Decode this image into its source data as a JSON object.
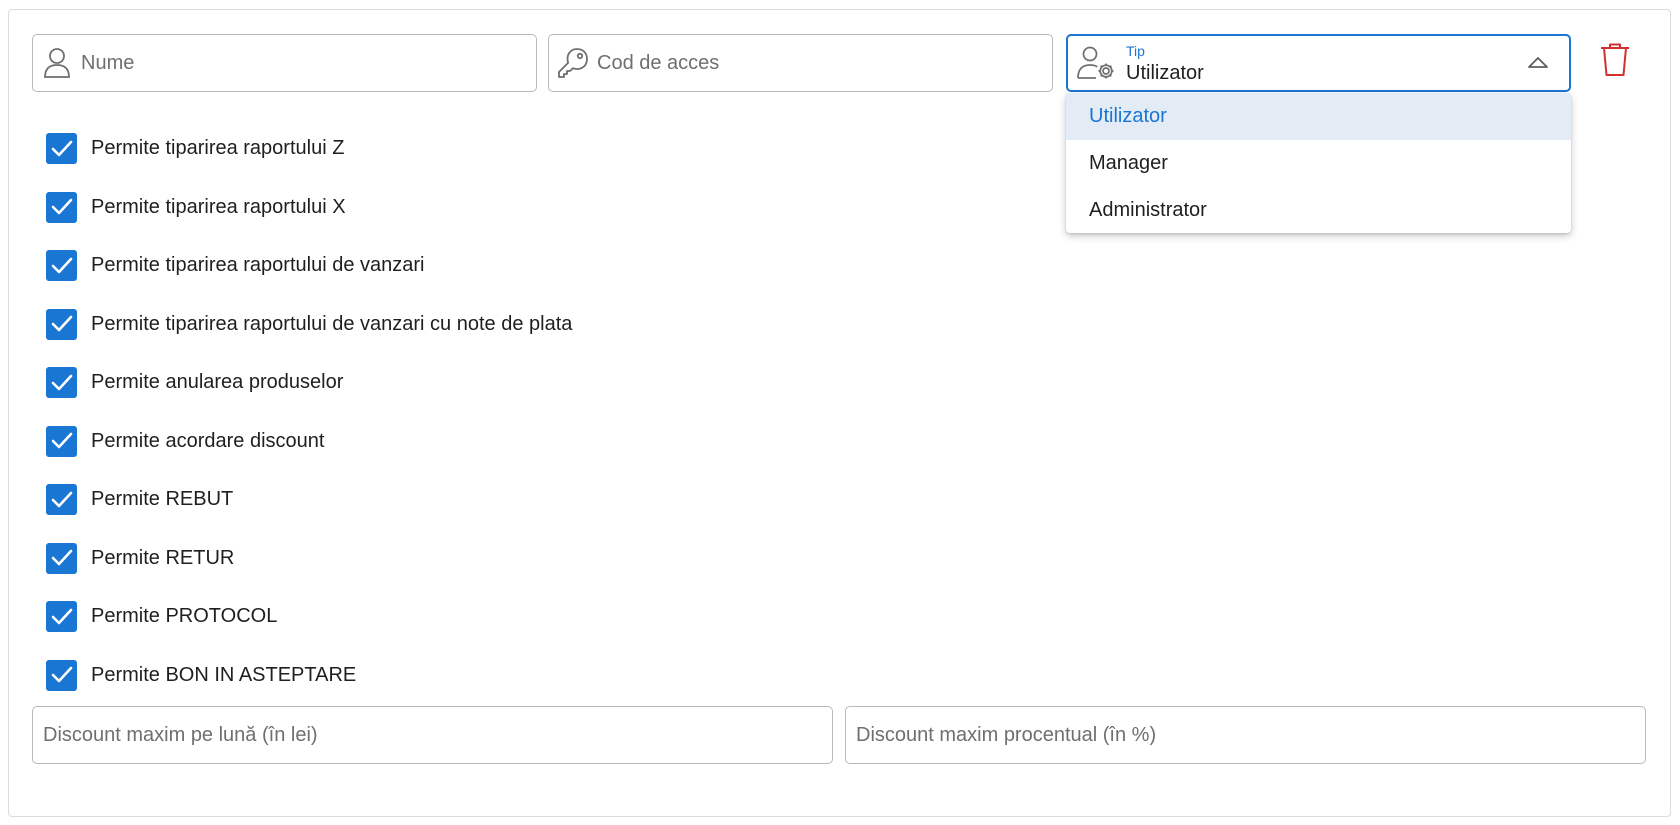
{
  "form": {
    "name_placeholder": "Nume",
    "access_code_placeholder": "Cod de acces",
    "type_label": "Tip",
    "type_value": "Utilizator",
    "type_options": [
      "Utilizator",
      "Manager",
      "Administrator"
    ],
    "type_selected_option": "Utilizator",
    "max_discount_month_placeholder": "Discount maxim pe lună (în lei)",
    "max_discount_percent_placeholder": "Discount maxim procentual (în %)"
  },
  "permissions": [
    {
      "label": "Permite tiparirea raportului Z",
      "checked": true
    },
    {
      "label": "Permite tiparirea raportului X",
      "checked": true
    },
    {
      "label": "Permite tiparirea raportului de vanzari",
      "checked": true
    },
    {
      "label": "Permite tiparirea raportului de vanzari cu note de plata",
      "checked": true
    },
    {
      "label": "Permite anularea produselor",
      "checked": true
    },
    {
      "label": "Permite acordare discount",
      "checked": true
    },
    {
      "label": "Permite REBUT",
      "checked": true
    },
    {
      "label": "Permite RETUR",
      "checked": true
    },
    {
      "label": "Permite PROTOCOL",
      "checked": true
    },
    {
      "label": "Permite BON IN ASTEPTARE",
      "checked": true
    }
  ],
  "icons": {
    "name": "user-icon",
    "access_code": "key-icon",
    "type": "user-settings-icon",
    "dropdown_caret": "chevron-up-icon",
    "delete": "trash-icon",
    "checkbox": "checkmark-icon"
  },
  "colors": {
    "accent": "#1976d2",
    "danger": "#d32f2f",
    "selected_option_bg": "#e3ebf5",
    "border": "#b9b9b9"
  }
}
